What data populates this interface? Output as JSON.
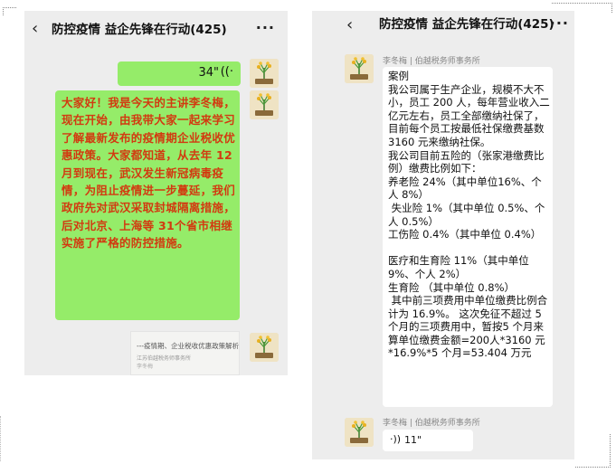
{
  "chat": {
    "title": "防控疫情  益企先锋在行动(425)",
    "back_icon": "←",
    "more_icon": "•••"
  },
  "left": {
    "voice_out": {
      "duration": "34\"",
      "wave_icon": "sound-wave-icon"
    },
    "intro_text": "大家好！我是今天的主讲李冬梅，现在开始，由我带大家一起来学习了解最新发布的疫情期企业税收优惠政策。大家都知道，从去年 12 月到现在，武汉发生新冠病毒疫情，为阻止疫情进一步蔓延，我们政府先对武汉采取封城隔离措施，后对北京、上海等 31个省市相继实施了严格的防控措施。",
    "link_card": {
      "title": "---疫情期、企业税收优惠政策解析",
      "subtitle": "江苏伯越税务师事务所",
      "author": "李冬梅"
    }
  },
  "right": {
    "sender": "李冬梅 | 伯越税务师事务所",
    "case_text": "案例\n我公司属于生产企业，规模不大不小，员工 200 人，每年营业收入二亿元左右，员工全部缴纳社保了，目前每个员工按最低社保缴费基数 3160 元来缴纳社保。\n我公司目前五险的（张家港缴费比例）缴费比例如下：\n养老险 24%（其中单位16%、个人 8%）\n 失业险 1%（其中单位 0.5%、个人 0.5%）\n工伤险 0.4%（其中单位 0.4%）\n\n医疗和生育险 11%（其中单位9%、个人 2%）\n生育险 （其中单位 0.8%）\n 其中前三项费用中单位缴费比例合计为 16.9%。 这次免征不超过 5 个月的三项费用中，暂按5 个月来算单位缴费金额=200人*3160 元*16.9%*5 个月=53.404 万元",
    "sender2": "李冬梅 | 伯越税务师事务所",
    "voice_in": {
      "duration": "11\"",
      "wave_icon": "sound-wave-icon"
    }
  },
  "colors": {
    "chat_bg": "#ededed",
    "green_bubble": "#95ec69",
    "intro_text": "#d23a10"
  }
}
